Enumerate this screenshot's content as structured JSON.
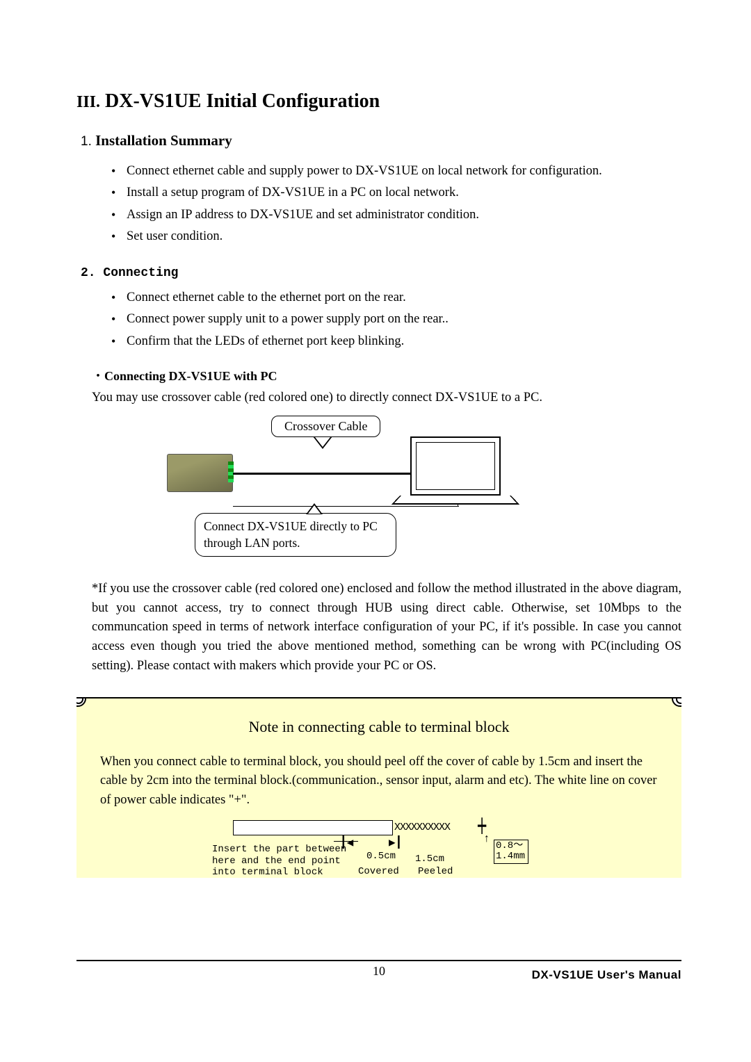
{
  "heading": {
    "roman": "III.",
    "title": "DX-VS1UE Initial Configuration"
  },
  "section1": {
    "num": "1.",
    "title": "Installation Summary",
    "bullets": [
      "Connect ethernet cable and supply power to DX-VS1UE on local network for configuration.",
      "Install a setup program of DX-VS1UE in a PC on local network.",
      "Assign an IP address to DX-VS1UE and set administrator condition.",
      "Set user condition."
    ]
  },
  "section2": {
    "num": "2.",
    "title": "Connecting",
    "bullets": [
      "Connect ethernet cable to the ethernet port on the rear.",
      "Connect power supply unit to a power supply port on the rear..",
      "Confirm that the LEDs of ethernet port keep blinking."
    ]
  },
  "sub": {
    "bullet": "・",
    "title": "Connecting DX-VS1UE with PC",
    "text": "You may use crossover cable (red colored one) to directly connect DX-VS1UE to a PC."
  },
  "diagram": {
    "crossover": "Crossover Cable",
    "connect_box": "Connect DX-VS1UE directly to PC through LAN ports."
  },
  "note_paragraph": "*If you use the crossover cable (red colored one) enclosed and follow the method illustrated in the above diagram, but you cannot access, try to connect through HUB using direct cable. Otherwise, set 10Mbps to the communcation speed in terms of network interface configuration of your PC, if it's possible. In case you cannot access even though you tried the above mentioned method, something can be wrong with PC(including OS setting). Please contact with makers which provide your PC or OS.",
  "note_block": {
    "title": "Note in connecting cable to terminal block",
    "body": "When you connect cable to terminal block, you should peel off the cover of cable by 1.5cm and insert the cable by 2cm into the terminal block.(communication., sensor input, alarm and etc). The white line on cover of power cable indicates \"+\".",
    "d": {
      "insert": "Insert the part between here and the end point into terminal block",
      "size05": "0.5cm",
      "size15": "1.5cm",
      "thickness": "0.8～ 1.4mm",
      "covered": "Covered",
      "peeled": "Peeled",
      "x": "XXXXXXXXXX"
    }
  },
  "footer": {
    "page": "10",
    "manual": "DX-VS1UE User's Manual"
  }
}
